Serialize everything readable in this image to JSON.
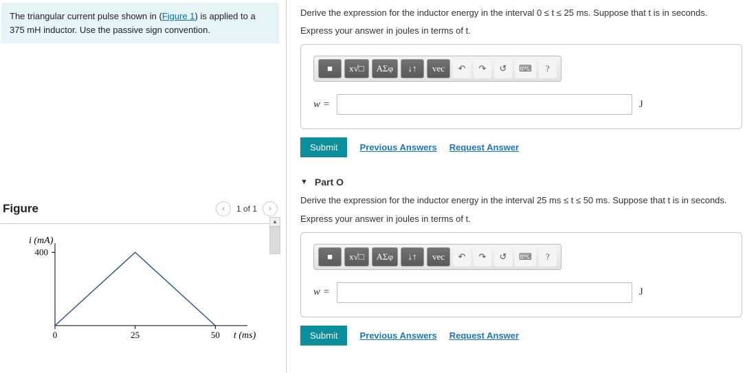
{
  "problem": {
    "text_before_link": "The triangular current pulse shown in (",
    "figure_link": "Figure 1",
    "text_after_link": ") is applied to a 375 mH inductor. Use the passive sign convention.",
    "inductance_mH": 375
  },
  "figure": {
    "title": "Figure",
    "pager": "1 of 1"
  },
  "chart_data": {
    "type": "line",
    "xlabel": "t (ms)",
    "ylabel": "i (mA)",
    "x": [
      0,
      25,
      50
    ],
    "y": [
      0,
      400,
      0
    ],
    "x_ticks": [
      0,
      25,
      50
    ],
    "y_ticks": [
      400
    ],
    "xlim": [
      0,
      60
    ],
    "ylim": [
      0,
      450
    ]
  },
  "toolbar": {
    "template_btn": "■",
    "sqrt_btn": "x√□",
    "greek_btn": "ΑΣφ",
    "subsup_btn": "↓↑",
    "vec_btn": "vec",
    "undo_btn": "↶",
    "redo_btn": "↷",
    "reset_btn": "↺",
    "keyboard_btn": "⌨",
    "help_btn": "?"
  },
  "partN": {
    "instruction": "Derive the expression for the inductor energy in the interval 0 ≤ t ≤ 25 ms. Suppose that t is in seconds.",
    "express": "Express your answer in joules in terms of t.",
    "label": "w =",
    "unit": "J",
    "submit": "Submit",
    "prev_answers": "Previous Answers",
    "req_answer": "Request Answer"
  },
  "partO": {
    "title": "Part O",
    "instruction": "Derive the expression for the inductor energy in the interval 25 ms ≤ t ≤ 50 ms. Suppose that t is in seconds.",
    "express": "Express your answer in joules in terms of t.",
    "label": "w =",
    "unit": "J",
    "submit": "Submit",
    "prev_answers": "Previous Answers",
    "req_answer": "Request Answer"
  }
}
